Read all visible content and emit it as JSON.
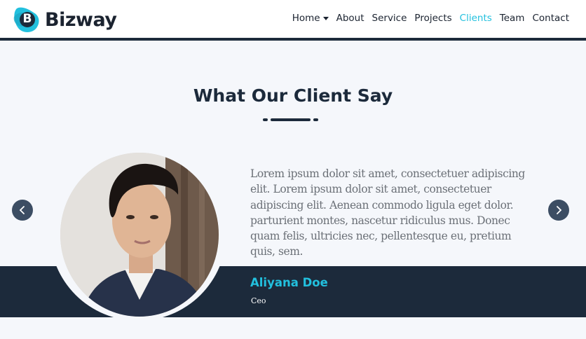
{
  "brand": {
    "name": "Bizway",
    "mark_letter": "B"
  },
  "nav": {
    "home": "Home",
    "about": "About",
    "service": "Service",
    "projects": "Projects",
    "clients": "Clients",
    "team": "Team",
    "contact": "Contact"
  },
  "section": {
    "title": "What Our Client Say"
  },
  "testimonial": {
    "quote": "Lorem ipsum dolor sit amet, consectetuer adipiscing elit. Lorem ipsum dolor sit amet, consectetuer adipiscing elit. Aenean commodo ligula eget dolor. parturient montes, nascetur ridiculus mus. Donec quam felis, ultricies nec, pellentesque eu, pretium quis, sem.",
    "name": "Aliyana Doe",
    "role": "Ceo"
  },
  "carousel": {
    "prev_icon": "chevron-left-icon",
    "next_icon": "chevron-right-icon"
  },
  "colors": {
    "accent": "#22c0de",
    "dark": "#1c2a3b",
    "background": "#f5f7fb"
  }
}
